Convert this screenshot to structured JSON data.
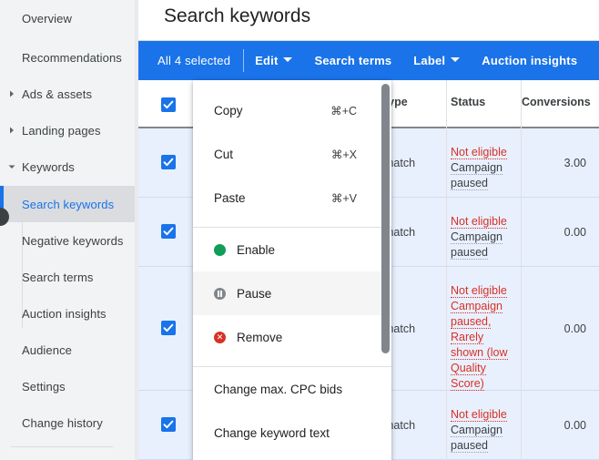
{
  "sidebar": {
    "items": [
      {
        "label": "Overview",
        "icon": null,
        "selected": false,
        "sub": false
      },
      {
        "label": "Recommendations",
        "icon": null,
        "selected": false,
        "sub": false
      },
      {
        "label": "Ads & assets",
        "icon": "chevron-right-icon",
        "selected": false,
        "sub": false
      },
      {
        "label": "Landing pages",
        "icon": "chevron-right-icon",
        "selected": false,
        "sub": false
      },
      {
        "label": "Keywords",
        "icon": "chevron-down-icon",
        "selected": false,
        "sub": false
      },
      {
        "label": "Search keywords",
        "icon": null,
        "selected": true,
        "sub": true
      },
      {
        "label": "Negative keywords",
        "icon": null,
        "selected": false,
        "sub": true
      },
      {
        "label": "Search terms",
        "icon": null,
        "selected": false,
        "sub": true
      },
      {
        "label": "Auction insights",
        "icon": null,
        "selected": false,
        "sub": true
      },
      {
        "label": "Audience",
        "icon": null,
        "selected": false,
        "sub": false
      },
      {
        "label": "Settings",
        "icon": null,
        "selected": false,
        "sub": false
      },
      {
        "label": "Change history",
        "icon": null,
        "selected": false,
        "sub": false
      }
    ]
  },
  "header": {
    "title": "Search keywords"
  },
  "action_bar": {
    "selected_label": "All 4 selected",
    "buttons": [
      {
        "label": "Edit",
        "caret": true
      },
      {
        "label": "Search terms",
        "caret": false
      },
      {
        "label": "Label",
        "caret": true
      },
      {
        "label": "Auction insights",
        "caret": false
      }
    ]
  },
  "table": {
    "columns": [
      {
        "key": "checkbox",
        "label": ""
      },
      {
        "key": "match_type",
        "label": "type"
      },
      {
        "key": "status",
        "label": "Status"
      },
      {
        "key": "conversions",
        "label": "Conversions"
      }
    ],
    "header_checkbox_checked": true,
    "rows": [
      {
        "checked": true,
        "match_type": "match",
        "status_main": "Not eligible",
        "status_detail": "Campaign paused",
        "conversions": "3.00"
      },
      {
        "checked": true,
        "match_type": "match",
        "status_main": "Not eligible",
        "status_detail": "Campaign paused",
        "conversions": "0.00"
      },
      {
        "checked": true,
        "match_type": "match",
        "status_main": "Not eligible",
        "status_detail": "Campaign paused, Rarely shown (low Quality Score)",
        "conversions": "0.00"
      },
      {
        "checked": true,
        "match_type": "match",
        "status_main": "Not eligible",
        "status_detail": "Campaign paused",
        "conversions": "0.00"
      }
    ]
  },
  "context_menu": {
    "groups": [
      {
        "items": [
          {
            "label": "Copy",
            "accel": "⌘+C",
            "icon": null,
            "hover": false
          },
          {
            "label": "Cut",
            "accel": "⌘+X",
            "icon": null,
            "hover": false
          },
          {
            "label": "Paste",
            "accel": "⌘+V",
            "icon": null,
            "hover": false
          }
        ]
      },
      {
        "items": [
          {
            "label": "Enable",
            "accel": "",
            "icon": "enable-circle-icon",
            "hover": false
          },
          {
            "label": "Pause",
            "accel": "",
            "icon": "pause-circle-icon",
            "hover": true
          },
          {
            "label": "Remove",
            "accel": "",
            "icon": "remove-circle-icon",
            "hover": false
          }
        ]
      },
      {
        "items": [
          {
            "label": "Change max. CPC bids",
            "accel": "",
            "icon": null,
            "hover": false
          },
          {
            "label": "Change keyword text",
            "accel": "",
            "icon": null,
            "hover": false
          }
        ]
      }
    ],
    "scrollbar_visible": true
  },
  "colors": {
    "accent_blue": "#1a73e8",
    "row_selected_blue": "#e8f0fe",
    "error_red": "#d93025",
    "enable_green": "#0f9d58",
    "pause_gray": "#80868b",
    "sidebar_bg": "#f1f3f4",
    "sidebar_selected_bg": "#dadce0"
  }
}
